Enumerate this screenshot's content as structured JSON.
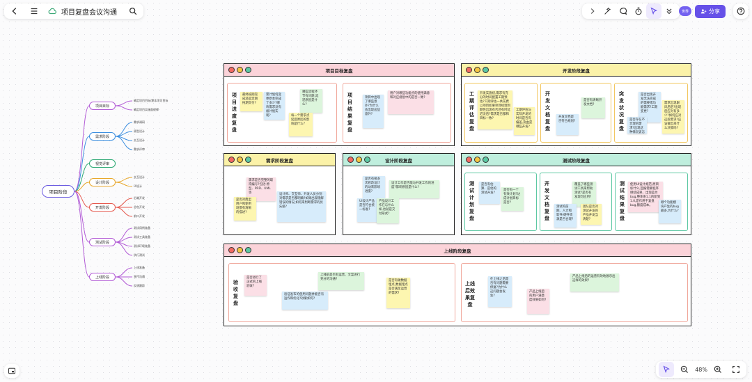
{
  "header": {
    "title": "项目复盘会议沟通",
    "share_label": "分享",
    "avatar_label": "世界"
  },
  "zoom": {
    "level": "48%"
  },
  "mindmap": {
    "root": "项目阶段",
    "branches": [
      {
        "label": "项目目标",
        "color": "#b25bd6",
        "children": [
          "确定项目目标/期本项可目标",
          "确定项目实施面规律"
        ]
      },
      {
        "label": "需求阶段",
        "color": "#3c8fe0",
        "children": [
          "需求调研",
          "原型设计",
          "交互设计",
          "需求评审"
        ]
      },
      {
        "label": "视觉评审",
        "color": "#2aa872",
        "children": []
      },
      {
        "label": "设计阶段",
        "color": "#e8a72a",
        "children": [
          "交互设计",
          "UI设计"
        ]
      },
      {
        "label": "开发阶段",
        "color": "#e65a4f",
        "children": [
          "后端开发",
          "总包开发",
          "前口开发"
        ]
      },
      {
        "label": "测试阶段",
        "color": "#b25bd6",
        "children": [
          "测试用例准备",
          "测试工具准备",
          "测试环境准备",
          "执行测试"
        ]
      },
      {
        "label": "上线阶段",
        "color": "#b25bd6",
        "children": [
          "上线准备",
          "宣传沟通",
          "反馈跟踪"
        ]
      }
    ]
  },
  "frames": {
    "goal": {
      "title": "项目目标复盘",
      "progress": {
        "label": "项目进度复盘",
        "notes": [
          "最终按期完成还是定期拖期交付?",
          "累计划何变更原本完成了多少?哪块需求没有被计划实现?",
          "哪些流程环节有问题,延迟原因是什么?",
          "每一个需求点延后原因的影响是什么?"
        ]
      },
      "result": {
        "label": "项目结果复盘",
        "notes": [
          "项目中出现了哪些意外?为什么会出现这些意外?",
          "用户对哪些功能点的使用满意和对应规划中的是否一致?"
        ]
      }
    },
    "dev": {
      "title": "开发阶段复盘",
      "eval": {
        "label": "工期评估复盘",
        "notes": [
          "开发实施初,需求有充分的时间配置工期预估?工期评估一共花费以项目如果项目经理到期性出现有否还有时延迟没后?需求是否都和目标一致?",
          "工期评估与实际开发的时间是否有偏差,及由是哪些开发?"
        ]
      },
      "doc": {
        "label": "开发文档复盘",
        "notes": [
          "开发文档是否符合规划?",
          "是否有清晰开发文档?"
        ]
      },
      "crash": {
        "label": "突发状况复盘",
        "notes": [
          "是否出现开发无法完成的需要或功能需求?工期变更?",
          "是否存在不合理的需求?出现这种情况该怎么处理?",
          "需求出现跟风后后?出现后应对有多少?如何应对这段需求?应该做出来什么决策吗?"
        ]
      }
    },
    "req": {
      "title": "需求阶段复盘",
      "notes": [
        "需求是否完整的取得编号?包括:原型、PRD、UML等",
        "是否对典型用户和使用场景有清晰的描述?",
        "设计师、交互师、开发人员分别对需求是否都明确?如果出现理解错误的情况,如何来判断需求的优先级?"
      ]
    },
    "design": {
      "title": "设计阶段复盘",
      "notes": [
        "是否有很多次修改设计的动来影响进度?",
        "UI设计产品是否符合统一标准?",
        "设计工作是否能与开发工作的进度?影响原因是什么?",
        "产品设计工作在与什么样,也就是交付形式?"
      ]
    },
    "test": {
      "title": "测试阶段复盘",
      "plan": {
        "label": "测试计划复盘",
        "notes": [
          "是否有估算、是他的测试开发?",
          "是否有一个有效计划?达成计划目标是否?"
        ]
      },
      "devdoc": {
        "label": "开发文档复盘",
        "notes": [
          "覆盖了哪些测试工具来帮助测试?是否有发现可应用?",
          "测试的前期、人力和软件/硬件资源是否合理?",
          "团队是否对测试开发的产品开发当清楚?"
        ]
      },
      "result": {
        "label": "测试结果复盘",
        "notes": [
          "使用UI设计规范,原目标什么,回报需要程序继续成果、出现些为bug,整体系1.1的新到1.0,是作用于复盘bug,额度成本。",
          "哪个功能模块产生的bug最多,为什么?"
        ]
      }
    },
    "launch": {
      "title": "上线阶段复盘",
      "accept": {
        "label": "验收复盘",
        "notes": [
          "是否进行了正式的上线验收?",
          "验证发布的使用问题并能否有运作和优化?效果如何?",
          "上线前是否有运营、文案进行充分的沟通?",
          "是否有做数据埋点,数据埋点是否满足运营的需求?"
        ]
      },
      "effect": {
        "label": "上线后效果复盘",
        "notes": [
          "在上线之后是否有问题需要修复?为什么这问题会发生?",
          "产品上线后的用户满意度效果如何?",
          "产品上线后的运营有效地展示出这样的效果?"
        ]
      }
    }
  }
}
